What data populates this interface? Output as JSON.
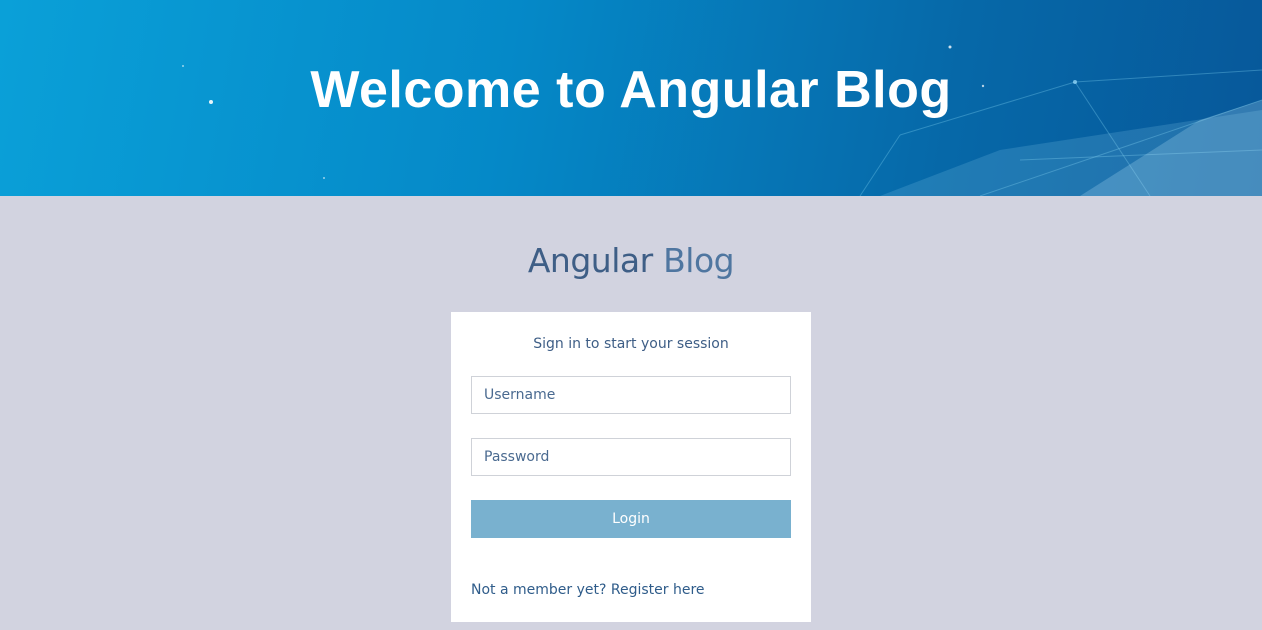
{
  "hero": {
    "title": "Welcome to Angular Blog"
  },
  "brand": {
    "bold": "Angular",
    "light": "Blog"
  },
  "login_card": {
    "message": "Sign in to start your session",
    "username_placeholder": "Username",
    "password_placeholder": "Password",
    "login_label": "Login",
    "register_link": "Not a member yet? Register here"
  },
  "colors": {
    "background": "#d2d3e0",
    "hero_blue": "#0589c8",
    "button": "#79b1cf",
    "text": "#3e5e86"
  }
}
